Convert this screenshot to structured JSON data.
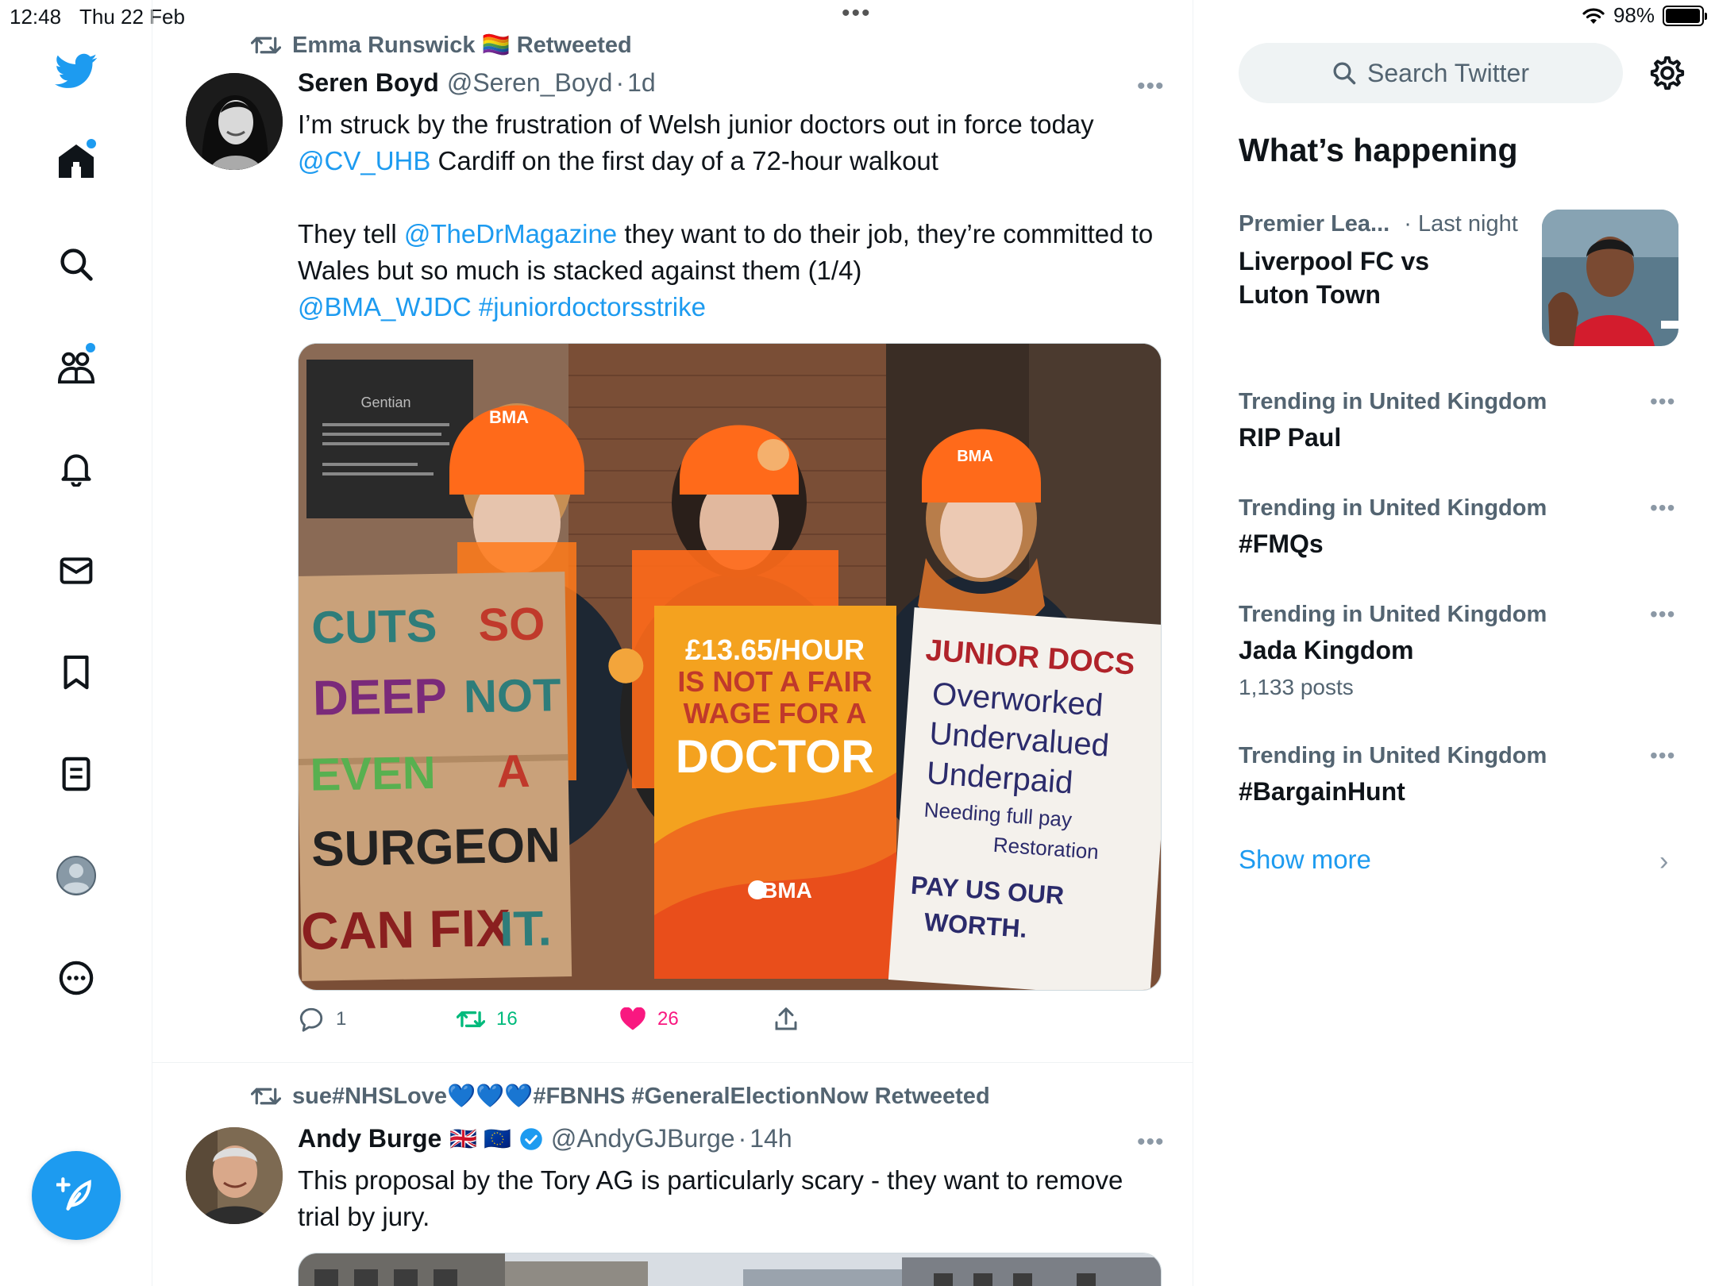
{
  "status_bar": {
    "time": "12:48",
    "date": "Thu 22 Feb",
    "dots": "•••",
    "battery": "98%",
    "battery_level": 0.98
  },
  "nav": {
    "items": [
      "home",
      "explore",
      "communities",
      "notifications",
      "messages",
      "bookmarks",
      "lists",
      "profile",
      "more"
    ]
  },
  "tweets": [
    {
      "retweeted_by": "Emma Runswick 🏳️‍🌈 Retweeted",
      "name": "Seren Boyd",
      "handle": "@Seren_Boyd",
      "sep": "·",
      "time": "1d",
      "more": "•••",
      "text_parts": {
        "p1a": "I’m struck by the frustration of Welsh junior doctors out in force today ",
        "m1": "@CV_UHB",
        "p1b": " Cardiff on the first day of a 72-hour walkout",
        "p2a": "They tell ",
        "m2": "@TheDrMagazine",
        "p2b": " they want to do their job, they’re committed to Wales but so much is stacked against them (1/4)",
        "m3": "@BMA_WJDC",
        "h1": "#juniordoctorsstrike"
      },
      "media": {
        "plaque": "Gentian",
        "sign1": [
          "CUTS",
          "SO",
          "DEEP",
          "NOT",
          "EVEN",
          "A",
          "SURGEON",
          "CAN FIX",
          "IT."
        ],
        "sign2": [
          "£13.65/HOUR",
          "IS NOT A FAIR",
          "WAGE FOR A",
          "DOCTOR"
        ],
        "sign2_brand": "BMA",
        "sign3": [
          "JUNIOR DOCS",
          "Overworked",
          "Undervalued",
          "Underpaid",
          "Needing full pay",
          "Restoration",
          "PAY US OUR",
          "WORTH."
        ],
        "hat_text": "BMA"
      },
      "replies": "1",
      "retweets": "16",
      "likes": "26"
    },
    {
      "retweeted_by": "sue#NHSLove💙💙💙#FBNHS #GeneralElectionNow Retweeted",
      "name": "Andy Burge",
      "flags": "🇬🇧 🇪🇺",
      "handle": "@AndyGJBurge",
      "sep": "·",
      "time": "14h",
      "more": "•••",
      "text": "This proposal by the Tory AG is particularly scary - they want to remove trial by jury."
    }
  ],
  "right": {
    "search_placeholder": "Search Twitter",
    "title": "What’s happening",
    "trends": [
      {
        "category": "Premier Lea...",
        "meta": "· Last night",
        "name": "Liverpool FC vs\nLuton Town"
      },
      {
        "category": "Trending in United Kingdom",
        "name": "RIP Paul",
        "more": "•••"
      },
      {
        "category": "Trending in United Kingdom",
        "name": "#FMQs",
        "more": "•••"
      },
      {
        "category": "Trending in United Kingdom",
        "name": "Jada Kingdom",
        "count": "1,133 posts",
        "more": "•••"
      },
      {
        "category": "Trending in United Kingdom",
        "name": "#BargainHunt",
        "more": "•••"
      }
    ],
    "show_more": "Show more",
    "chevron": "›"
  },
  "colors": {
    "accent": "#1d9bf0",
    "like": "#f91880",
    "retweet": "#00ba7c",
    "secondary": "#536471"
  }
}
